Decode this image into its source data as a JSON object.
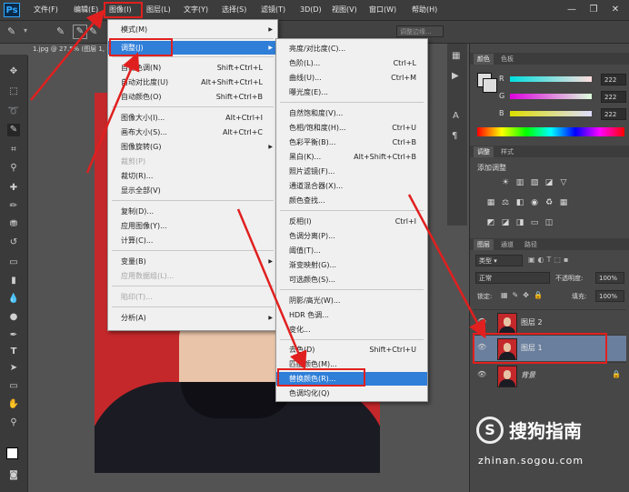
{
  "app": {
    "logo": "Ps"
  },
  "menubar": {
    "items": [
      "文件(F)",
      "编辑(E)",
      "图像(I)",
      "图层(L)",
      "文字(Y)",
      "选择(S)",
      "滤镜(T)",
      "3D(D)",
      "视图(V)",
      "窗口(W)",
      "帮助(H)"
    ],
    "window_buttons": [
      "—",
      "❐",
      "✕"
    ]
  },
  "options_bar": {
    "right_field": "调整边缘..."
  },
  "document": {
    "tab": "1.jpg @ 27.5% (图层 1, RGB/8)"
  },
  "image_menu": {
    "items": [
      {
        "label": "模式(M)",
        "shortcut": "",
        "submenu": true,
        "disabled": false
      },
      {
        "label": "调整(J)",
        "shortcut": "",
        "submenu": true,
        "disabled": false,
        "highlighted": true
      },
      {
        "label": "自动色调(N)",
        "shortcut": "Shift+Ctrl+L",
        "disabled": false
      },
      {
        "label": "自动对比度(U)",
        "shortcut": "Alt+Shift+Ctrl+L",
        "disabled": false
      },
      {
        "label": "自动颜色(O)",
        "shortcut": "Shift+Ctrl+B",
        "disabled": false
      },
      {
        "label": "图像大小(I)...",
        "shortcut": "Alt+Ctrl+I",
        "disabled": false
      },
      {
        "label": "画布大小(S)...",
        "shortcut": "Alt+Ctrl+C",
        "disabled": false
      },
      {
        "label": "图像旋转(G)",
        "shortcut": "",
        "submenu": true,
        "disabled": false
      },
      {
        "label": "裁剪(P)",
        "shortcut": "",
        "disabled": true
      },
      {
        "label": "裁切(R)...",
        "shortcut": "",
        "disabled": false
      },
      {
        "label": "显示全部(V)",
        "shortcut": "",
        "disabled": false
      },
      {
        "label": "复制(D)...",
        "shortcut": "",
        "disabled": false
      },
      {
        "label": "应用图像(Y)...",
        "shortcut": "",
        "disabled": false
      },
      {
        "label": "计算(C)...",
        "shortcut": "",
        "disabled": false
      },
      {
        "label": "变量(B)",
        "shortcut": "",
        "submenu": true,
        "disabled": false
      },
      {
        "label": "应用数据组(L)...",
        "shortcut": "",
        "disabled": true
      },
      {
        "label": "陷印(T)...",
        "shortcut": "",
        "disabled": true
      },
      {
        "label": "分析(A)",
        "shortcut": "",
        "submenu": true,
        "disabled": false
      }
    ]
  },
  "adjust_submenu": {
    "items": [
      {
        "label": "亮度/对比度(C)...",
        "shortcut": ""
      },
      {
        "label": "色阶(L)...",
        "shortcut": "Ctrl+L"
      },
      {
        "label": "曲线(U)...",
        "shortcut": "Ctrl+M"
      },
      {
        "label": "曝光度(E)...",
        "shortcut": ""
      },
      {
        "label": "自然饱和度(V)...",
        "shortcut": ""
      },
      {
        "label": "色相/饱和度(H)...",
        "shortcut": "Ctrl+U"
      },
      {
        "label": "色彩平衡(B)...",
        "shortcut": "Ctrl+B"
      },
      {
        "label": "黑白(K)...",
        "shortcut": "Alt+Shift+Ctrl+B"
      },
      {
        "label": "照片滤镜(F)...",
        "shortcut": ""
      },
      {
        "label": "通道混合器(X)...",
        "shortcut": ""
      },
      {
        "label": "颜色查找...",
        "shortcut": ""
      },
      {
        "label": "反相(I)",
        "shortcut": "Ctrl+I"
      },
      {
        "label": "色调分离(P)...",
        "shortcut": ""
      },
      {
        "label": "阈值(T)...",
        "shortcut": ""
      },
      {
        "label": "渐变映射(G)...",
        "shortcut": ""
      },
      {
        "label": "可选颜色(S)...",
        "shortcut": ""
      },
      {
        "label": "阴影/高光(W)...",
        "shortcut": ""
      },
      {
        "label": "HDR 色调...",
        "shortcut": ""
      },
      {
        "label": "变化...",
        "shortcut": ""
      },
      {
        "label": "去色(D)",
        "shortcut": "Shift+Ctrl+U"
      },
      {
        "label": "匹配颜色(M)...",
        "shortcut": ""
      },
      {
        "label": "替换颜色(R)...",
        "shortcut": "",
        "highlighted": true
      },
      {
        "label": "色调均化(Q)",
        "shortcut": ""
      }
    ]
  },
  "color_panel": {
    "tabs": [
      "颜色",
      "色板"
    ],
    "channels": [
      {
        "name": "R",
        "value": "222",
        "gradient": "linear-gradient(90deg,#00dede,#ffdede)"
      },
      {
        "name": "G",
        "value": "222",
        "gradient": "linear-gradient(90deg,#de00de,#deffde)"
      },
      {
        "name": "B",
        "value": "222",
        "gradient": "linear-gradient(90deg,#dede00,#dedeff)"
      }
    ]
  },
  "adjustments_panel": {
    "tabs": [
      "调整",
      "样式"
    ],
    "title": "添加调整"
  },
  "layers_panel": {
    "tabs": [
      "图层",
      "通道",
      "路径"
    ],
    "filter_kind": "类型",
    "blend_mode": "正常",
    "opacity_label": "不透明度:",
    "opacity": "100%",
    "lock_label": "锁定:",
    "fill_label": "填充:",
    "fill": "100%",
    "layers": [
      {
        "name": "图层 2",
        "selected": false
      },
      {
        "name": "图层 1",
        "selected": true
      },
      {
        "name": "背景",
        "selected": false,
        "locked": true
      }
    ]
  },
  "watermark": {
    "brand": "搜狗指南",
    "url": "zhinan.sogou.com"
  },
  "colors": {
    "accent": "#2f7ed8",
    "annotation": "#e0201f",
    "photo_bg": "#c4282b"
  }
}
